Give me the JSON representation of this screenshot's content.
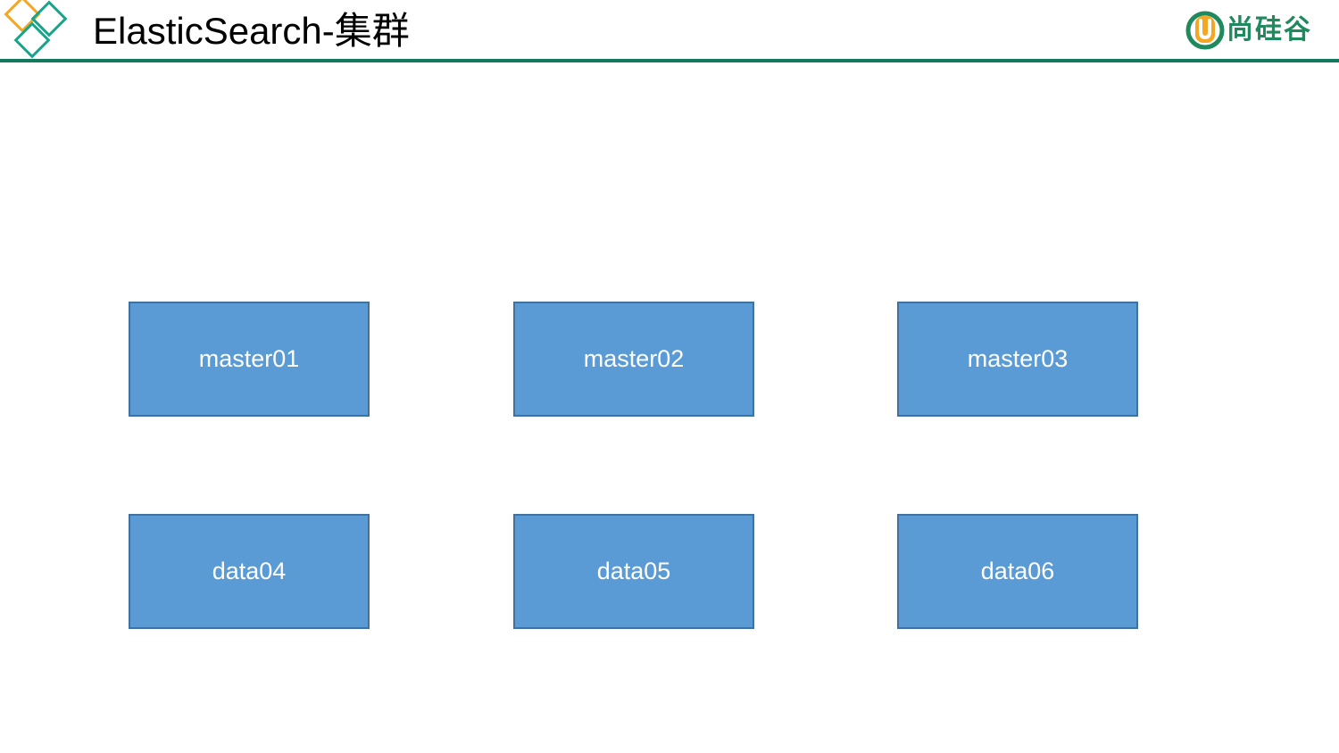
{
  "header": {
    "title": "ElasticSearch-集群",
    "brand_name": "尚硅谷",
    "corner_logo_icon": "diamond-logo-icon",
    "brand_icon": "u-logo-icon"
  },
  "colors": {
    "accent_rule": "#137a5e",
    "brand_green": "#1f8a5e",
    "brand_orange": "#f5a623",
    "logo_orange": "#f5a623",
    "logo_teal": "#1aa58a",
    "node_fill": "#5b9bd5",
    "node_border": "#41719c",
    "node_text": "#ffffff"
  },
  "diagram": {
    "master_nodes": [
      {
        "label": "master01"
      },
      {
        "label": "master02"
      },
      {
        "label": "master03"
      }
    ],
    "data_nodes": [
      {
        "label": "data04"
      },
      {
        "label": "data05"
      },
      {
        "label": "data06"
      }
    ]
  }
}
